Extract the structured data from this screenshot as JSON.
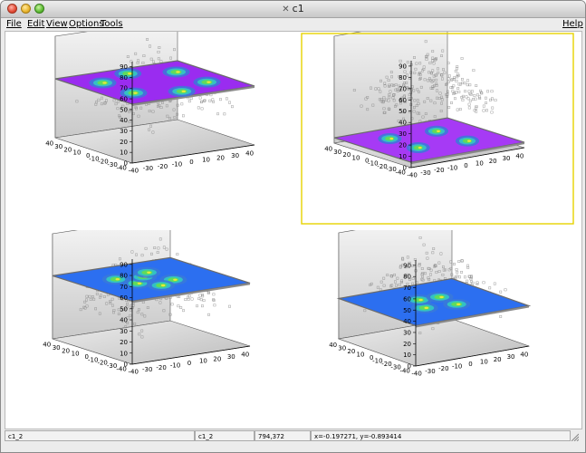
{
  "window": {
    "title": "c1"
  },
  "menu": {
    "file": "File",
    "edit": "Edit",
    "view": "View",
    "options": "Options",
    "tools": "Tools",
    "help": "Help"
  },
  "pads": [
    {
      "ticks_z": [
        "90",
        "80",
        "70",
        "60",
        "50",
        "40",
        "30",
        "20",
        "10",
        "0"
      ],
      "ticks_y": [
        "40",
        "30",
        "20",
        "10",
        "0",
        "-10",
        "-20",
        "-30",
        "-40"
      ],
      "ticks_x": [
        "-40",
        "-30",
        "-20",
        "-10",
        "0",
        "10",
        "20",
        "30",
        "40"
      ],
      "plane_color": "#9a2cf0",
      "selected": false
    },
    {
      "ticks_z": [
        "90",
        "80",
        "70",
        "60",
        "50",
        "40",
        "30",
        "20",
        "10",
        "0"
      ],
      "ticks_y": [
        "40",
        "30",
        "20",
        "10",
        "0",
        "-10",
        "-20",
        "-30",
        "-40"
      ],
      "ticks_x": [
        "-40",
        "-30",
        "-20",
        "-10",
        "0",
        "10",
        "20",
        "30",
        "40"
      ],
      "plane_color": "#a63af5",
      "selected": true
    },
    {
      "ticks_z": [
        "90",
        "80",
        "70",
        "60",
        "50",
        "40",
        "30",
        "20",
        "10",
        "0"
      ],
      "ticks_y": [
        "40",
        "30",
        "20",
        "10",
        "0",
        "-10",
        "-20",
        "-30",
        "-40"
      ],
      "ticks_x": [
        "-40",
        "-30",
        "-20",
        "-10",
        "0",
        "10",
        "20",
        "30",
        "40"
      ],
      "plane_color": "#2c6ff0",
      "selected": false
    },
    {
      "ticks_z": [
        "90",
        "80",
        "70",
        "60",
        "50",
        "40",
        "30",
        "20",
        "10",
        "0"
      ],
      "ticks_y": [
        "40",
        "30",
        "20",
        "10",
        "0",
        "-10",
        "-20",
        "-30",
        "-40"
      ],
      "ticks_x": [
        "-40",
        "-30",
        "-20",
        "-10",
        "0",
        "10",
        "20",
        "30",
        "40"
      ],
      "plane_color": "#2c6ff0",
      "selected": false
    }
  ],
  "status": {
    "object": "c1_2",
    "pad": "c1_2",
    "pixel": "794,372",
    "coords": "x=-0.197271, y=-0.893414"
  }
}
